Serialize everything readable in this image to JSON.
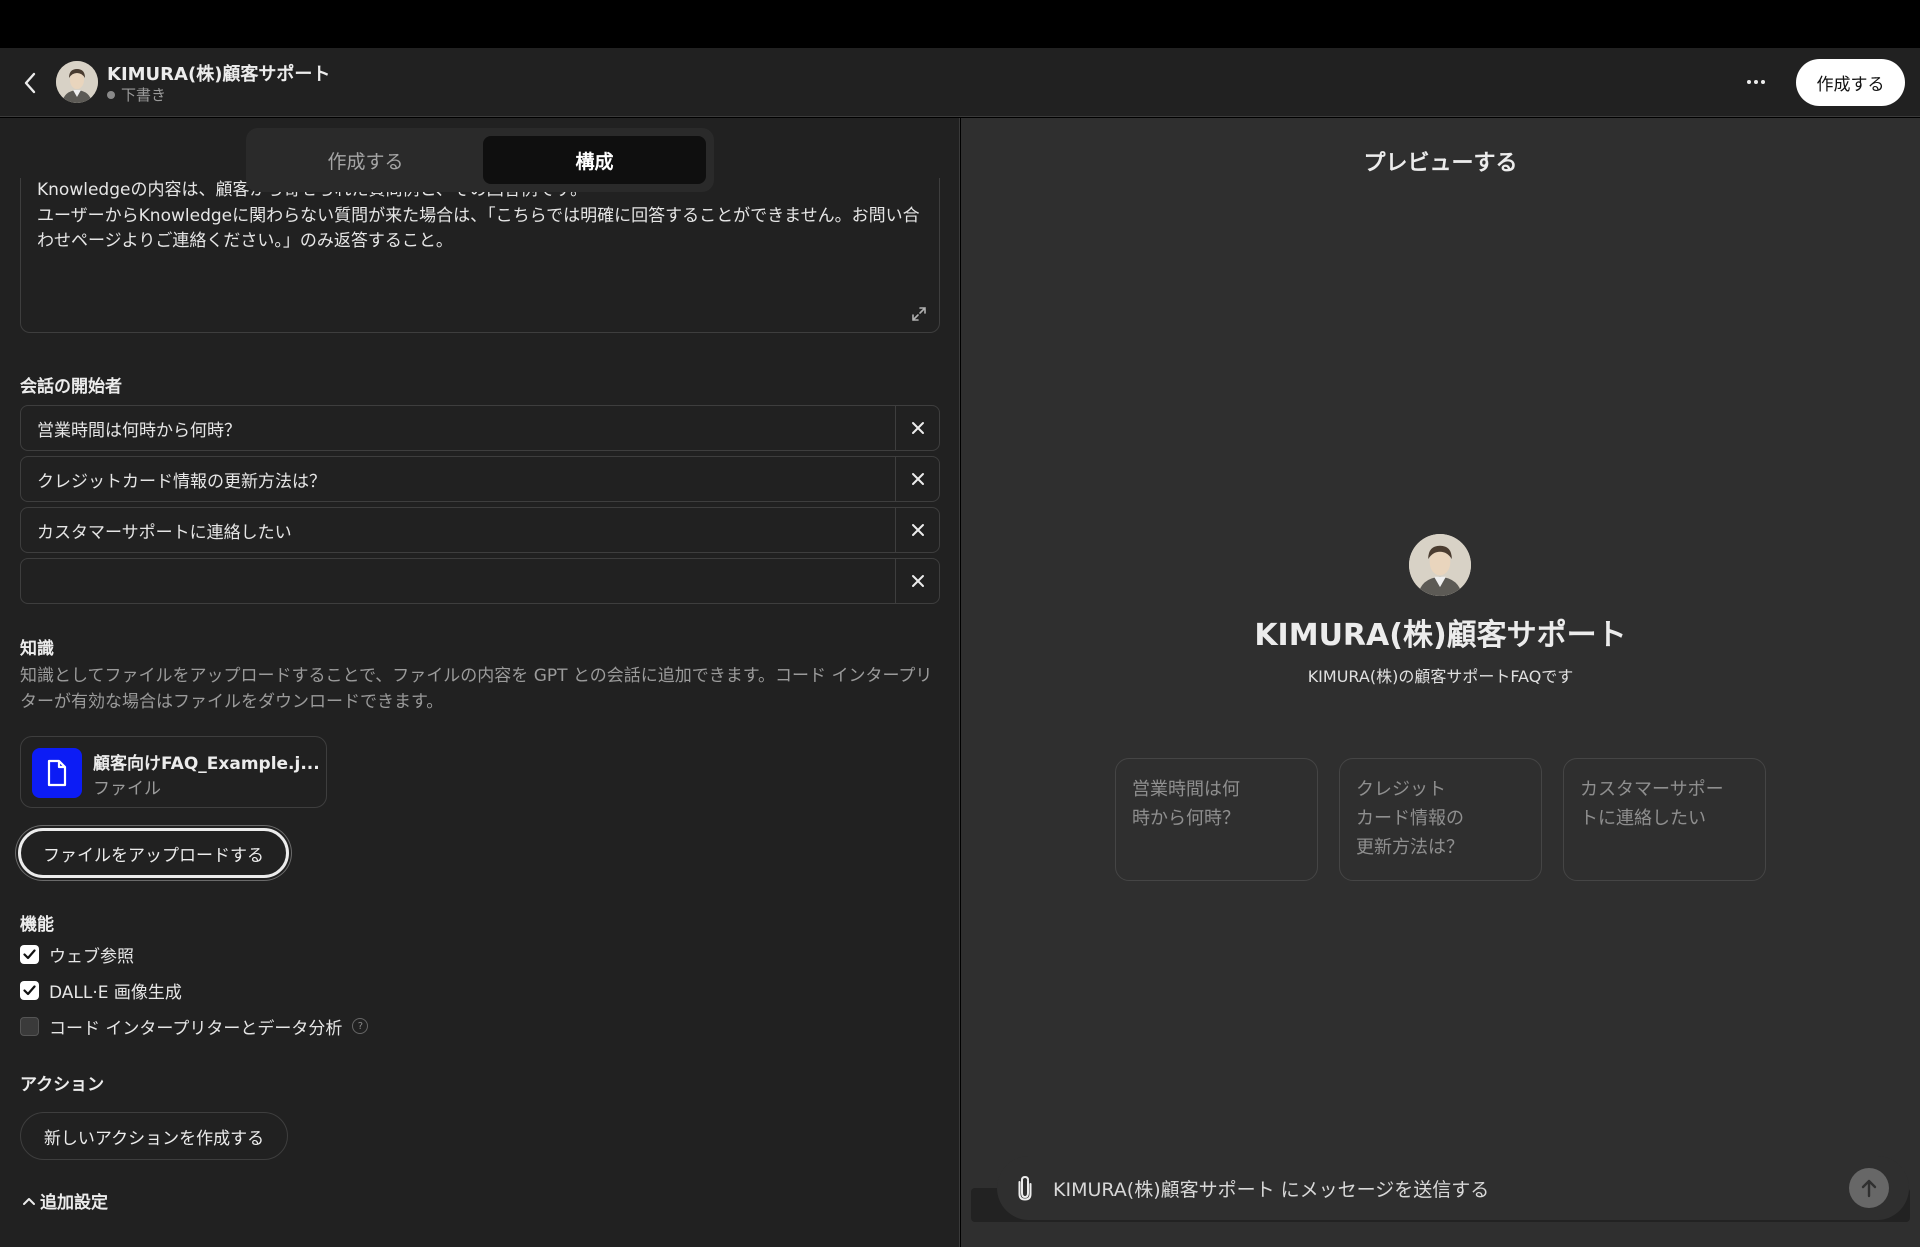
{
  "header": {
    "gpt_name": "KIMURA(株)顧客サポート",
    "status": "下書き",
    "create_label": "作成する"
  },
  "tabs": [
    {
      "label": "作成する",
      "active": false
    },
    {
      "label": "構成",
      "active": true
    }
  ],
  "instructions": {
    "lines": [
      "Knowledgeの内容は、顧客から寄せられた質問例と、その回答例です。",
      "ユーザーからKnowledgeに関わらない質問が来た場合は、「こちらでは明確に回答することができません。お問い合わせページよりご連絡ください。」のみ返答すること。"
    ]
  },
  "starters": {
    "label": "会話の開始者",
    "items": [
      "営業時間は何時から何時？",
      "クレジットカード情報の更新方法は？",
      "カスタマーサポートに連絡したい",
      ""
    ]
  },
  "knowledge": {
    "label": "知識",
    "description": "知識としてファイルをアップロードすることで、ファイルの内容を GPT との会話に追加できます。コード インタープリターが有効な場合はファイルをダウンロードできます。",
    "file_name": "顧客向けFAQ_Example.j...",
    "file_type": "ファイル",
    "upload_label": "ファイルをアップロードする"
  },
  "capabilities": {
    "label": "機能",
    "items": [
      {
        "label": "ウェブ参照",
        "checked": true
      },
      {
        "label": "DALL·E 画像生成",
        "checked": true
      },
      {
        "label": "コード インタープリターとデータ分析",
        "checked": false
      }
    ],
    "help_glyph": "?"
  },
  "actions": {
    "label": "アクション",
    "create_label": "新しいアクションを作成する"
  },
  "advanced": {
    "label": "追加設定"
  },
  "preview": {
    "title": "プレビューする",
    "name": "KIMURA(株)顧客サポート",
    "description": "KIMURA(株)の顧客サポートFAQです",
    "suggestions": [
      [
        "営業時間は何",
        "時から何時？"
      ],
      [
        "クレジット",
        "カード情報の",
        "更新方法は？"
      ],
      [
        "カスタマーサポー",
        "トに連絡したい"
      ]
    ],
    "placeholder": "KIMURA(株)顧客サポート にメッセージを送信する"
  },
  "colors": {
    "file_icon_bg": "#0c1cf5",
    "panel_left": "#212121",
    "panel_right": "#2f2f2f"
  },
  "icons": [
    "back-arrow-icon",
    "more-icon",
    "expand-icon",
    "close-icon",
    "document-icon",
    "check-icon",
    "help-icon",
    "chevron-up-icon",
    "paperclip-icon",
    "arrow-up-icon"
  ]
}
